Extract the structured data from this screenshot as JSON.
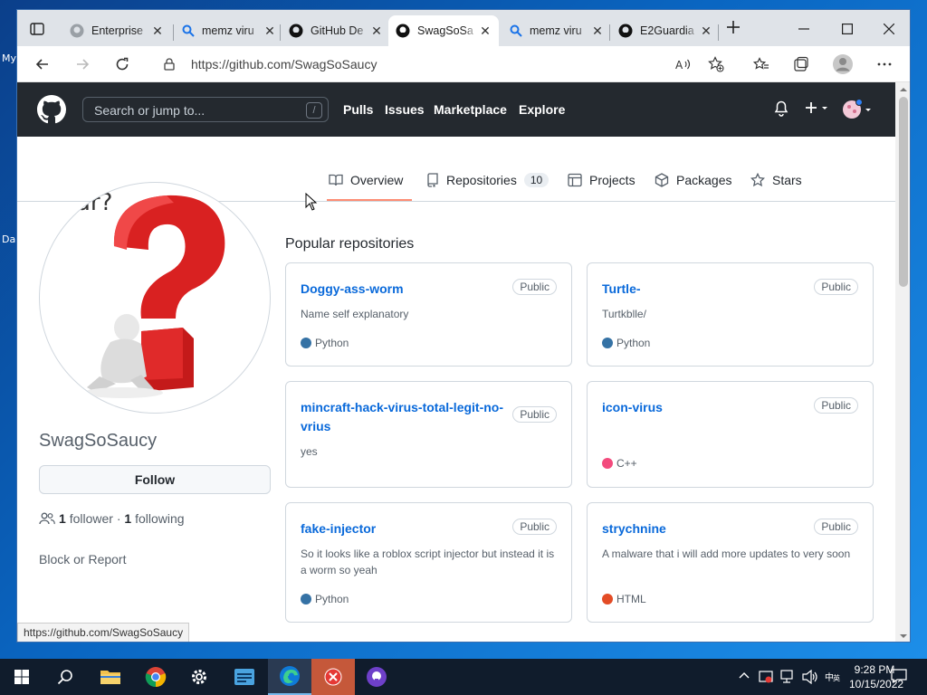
{
  "desktop": {
    "fragments": [
      "My",
      "Da"
    ]
  },
  "browser": {
    "tabs": [
      {
        "title": "Enterprise",
        "icon": "github-icon"
      },
      {
        "title": "memz viru",
        "icon": "search-icon"
      },
      {
        "title": "GitHub De",
        "icon": "github-icon"
      },
      {
        "title": "SwagSoSa",
        "icon": "github-icon",
        "active": true
      },
      {
        "title": "memz viru",
        "icon": "search-icon"
      },
      {
        "title": "E2Guardia",
        "icon": "github-icon"
      }
    ],
    "url": "https://github.com/SwagSoSaucy",
    "status_url": "https://github.com/SwagSoSaucy"
  },
  "github_header": {
    "search_placeholder": "Search or jump to...",
    "search_shortcut": "/",
    "nav": [
      "Pulls",
      "Issues",
      "Marketplace",
      "Explore"
    ]
  },
  "profile_nav": {
    "items": [
      {
        "label": "Overview",
        "icon": "book-icon",
        "selected": true
      },
      {
        "label": "Repositories",
        "icon": "repo-icon",
        "count": "10"
      },
      {
        "label": "Projects",
        "icon": "table-icon"
      },
      {
        "label": "Packages",
        "icon": "package-icon"
      },
      {
        "label": "Stars",
        "icon": "star-icon"
      }
    ]
  },
  "profile": {
    "avatar_text": "ar?",
    "username": "SwagSoSaucy",
    "follow_label": "Follow",
    "followers_count": "1",
    "followers_label": "follower",
    "separator": "·",
    "following_count": "1",
    "following_label": "following",
    "block_report": "Block or Report"
  },
  "repos": {
    "heading": "Popular repositories",
    "items": [
      {
        "name": "Doggy-ass-worm",
        "visibility": "Public",
        "description": "Name self explanatory",
        "language": "Python",
        "lang_color": "#3572A5"
      },
      {
        "name": "Turtle-",
        "visibility": "Public",
        "description": "Turtkblle/",
        "language": "Python",
        "lang_color": "#3572A5"
      },
      {
        "name": "mincraft-hack-virus-total-legit-no-vrius",
        "visibility": "Public",
        "description": "yes",
        "language": "",
        "lang_color": ""
      },
      {
        "name": "icon-virus",
        "visibility": "Public",
        "description": "",
        "language": "C++",
        "lang_color": "#f34b7d"
      },
      {
        "name": "fake-injector",
        "visibility": "Public",
        "description": "So it looks like a roblox script injector but instead it is a worm so yeah",
        "language": "Python",
        "lang_color": "#3572A5"
      },
      {
        "name": "strychnine",
        "visibility": "Public",
        "description": "A malware that i will add more updates to very soon",
        "language": "HTML",
        "lang_color": "#e34c26"
      }
    ]
  },
  "taskbar": {
    "time": "9:28 PM",
    "date": "10/15/2022"
  }
}
